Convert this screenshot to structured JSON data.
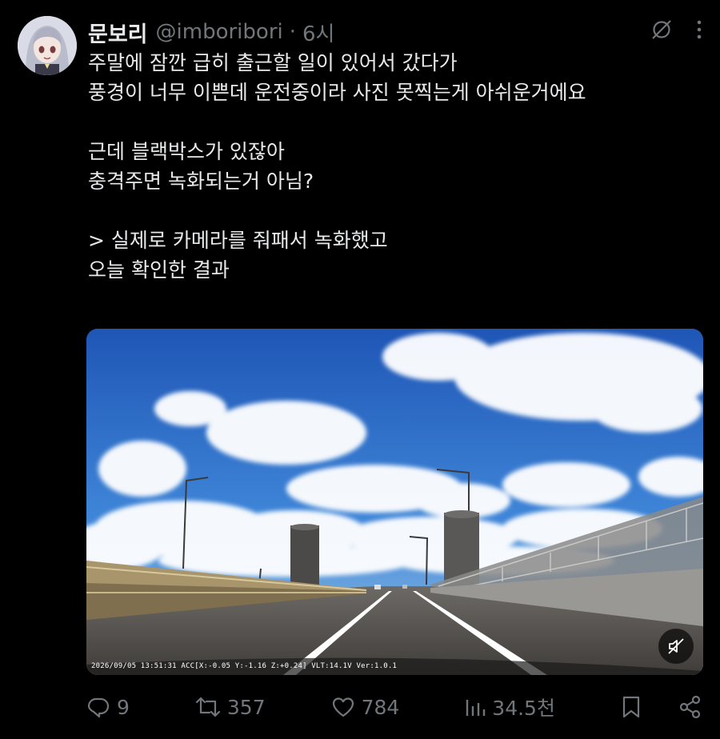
{
  "tweet": {
    "author": {
      "display_name": "문보리",
      "handle": "@imboribori",
      "separator": "·",
      "time": "6시"
    },
    "lines": [
      "주말에 잠깐 급히 출근할 일이 있어서 갔다가",
      "풍경이 너무 이쁜데 운전중이라 사진 못찍는게 아쉬운거에요",
      "",
      "근데 블랙박스가 있잖아",
      "충격주면 녹화되는거 아님?",
      "",
      "> 실제로 카메라를 줘패서 녹화했고",
      "오늘 확인한 결과"
    ],
    "media": {
      "overlay": "2026/09/05 13:51:31 ACC[X:-0.05 Y:-1.16 Z:+0.24] VLT:14.1V Ver:1.0.1"
    },
    "stats": {
      "replies": "9",
      "reposts": "357",
      "likes": "784",
      "views": "34.5천"
    },
    "icons": {
      "top": [
        "grok-icon",
        "more-icon"
      ],
      "media": "mute-icon",
      "actions": [
        "reply-icon",
        "repost-icon",
        "like-icon",
        "views-icon",
        "bookmark-icon",
        "share-icon"
      ]
    },
    "colors": {
      "background": "#000000",
      "text": "#e7e9ea",
      "secondary": "#71767b"
    }
  }
}
